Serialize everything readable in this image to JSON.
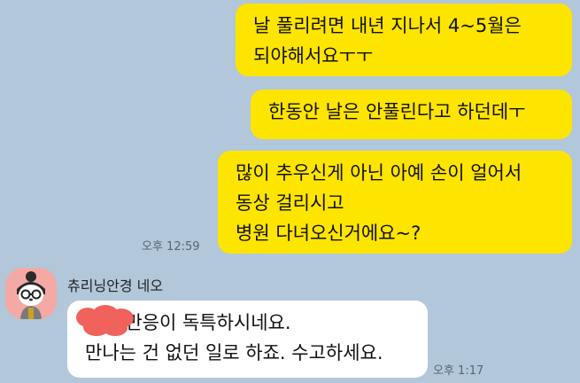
{
  "colors": {
    "background": "#b2c7d9",
    "outgoing_bubble": "#fee500",
    "incoming_bubble": "#ffffff",
    "avatar_bg": "#f4a9a5",
    "redaction": "#f0625b"
  },
  "messages": [
    {
      "direction": "outgoing",
      "text": "날 풀리려면 내년 지나서 4~5월은\n되야해서요ㅜㅜ"
    },
    {
      "direction": "outgoing",
      "text": "한동안 날은 안풀린다고 하던데ㅜ"
    },
    {
      "direction": "outgoing",
      "text": "많이 추우신게 아닌 아예 손이 얼어서\n동상 걸리시고\n병원 다녀오신거에요~?"
    },
    {
      "direction": "incoming",
      "text": "    시는 반응이 독특하시네요.\n만나는 건 없던 일로 하죠. 수고하세요."
    }
  ],
  "timestamps": {
    "outgoing_last": "오후 12:59",
    "incoming_last": "오후 1:17"
  },
  "sender": {
    "name": "츄리닝안경 네오",
    "avatar_icon": "neo-character-icon"
  },
  "redaction_icon": "red-heart-scribble-icon"
}
